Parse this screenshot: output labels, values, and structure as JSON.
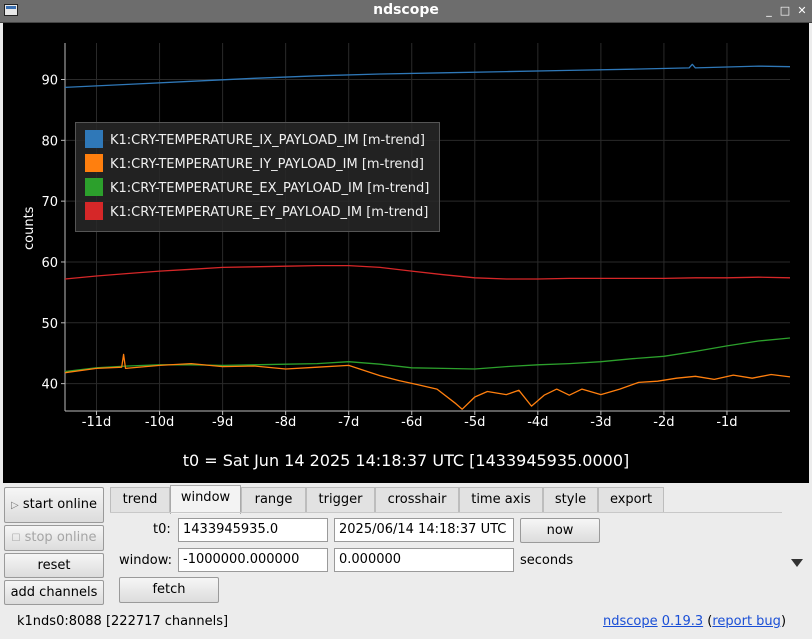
{
  "window": {
    "title": "ndscope"
  },
  "window_buttons": [
    "_",
    "□",
    "✕"
  ],
  "plot": {
    "ylabel": "counts",
    "t0_label": "t0 = Sat Jun 14 2025 14:18:37 UTC [1433945935.0000]",
    "legend": [
      {
        "name": "K1:CRY-TEMPERATURE_IX_PAYLOAD_IM [m-trend]",
        "color": "#2f78b8"
      },
      {
        "name": "K1:CRY-TEMPERATURE_IY_PAYLOAD_IM [m-trend]",
        "color": "#ff7f0e"
      },
      {
        "name": "K1:CRY-TEMPERATURE_EX_PAYLOAD_IM [m-trend]",
        "color": "#2ca02c"
      },
      {
        "name": "K1:CRY-TEMPERATURE_EY_PAYLOAD_IM [m-trend]",
        "color": "#d62728"
      }
    ]
  },
  "chart_data": {
    "type": "line",
    "title": "",
    "xlabel": "",
    "ylabel": "counts",
    "xlim": [
      -11.5,
      0
    ],
    "ylim": [
      35.5,
      96
    ],
    "xticks": [
      -11,
      -10,
      -9,
      -8,
      -7,
      -6,
      -5,
      -4,
      -3,
      -2,
      -1
    ],
    "xtick_labels": [
      "-11d",
      "-10d",
      "-9d",
      "-8d",
      "-7d",
      "-6d",
      "-5d",
      "-4d",
      "-3d",
      "-2d",
      "-1d"
    ],
    "yticks": [
      40,
      50,
      60,
      70,
      80,
      90
    ],
    "grid": true,
    "legend_position": "top-left",
    "series": [
      {
        "name": "K1:CRY-TEMPERATURE_IX_PAYLOAD_IM [m-trend]",
        "color": "#2f78b8",
        "x": [
          -11.5,
          -10.5,
          -9.5,
          -8.5,
          -7.5,
          -6.5,
          -5.5,
          -4.5,
          -3.5,
          -2.5,
          -1.6,
          -1.55,
          -1.5,
          -0.5,
          0
        ],
        "y": [
          88.7,
          89.2,
          89.7,
          90.2,
          90.6,
          90.9,
          91.1,
          91.3,
          91.5,
          91.7,
          91.9,
          92.5,
          91.9,
          92.2,
          92.1
        ]
      },
      {
        "name": "K1:CRY-TEMPERATURE_IY_PAYLOAD_IM [m-trend]",
        "color": "#ff7f0e",
        "x": [
          -11.5,
          -11,
          -10.6,
          -10.57,
          -10.54,
          -10,
          -9.5,
          -9,
          -8.5,
          -8,
          -7.5,
          -7,
          -6.5,
          -6.2,
          -5.9,
          -5.6,
          -5.3,
          -5.2,
          -5,
          -4.8,
          -4.5,
          -4.3,
          -4.1,
          -3.9,
          -3.7,
          -3.5,
          -3.3,
          -3,
          -2.7,
          -2.4,
          -2.1,
          -1.8,
          -1.5,
          -1.2,
          -0.9,
          -0.6,
          -0.3,
          0
        ],
        "y": [
          41.8,
          42.5,
          42.7,
          44.8,
          42.5,
          43,
          43.3,
          42.8,
          42.9,
          42.4,
          42.7,
          43,
          41.3,
          40.5,
          39.8,
          39.1,
          36.7,
          35.8,
          37.8,
          38.7,
          38.2,
          38.9,
          36.3,
          38.1,
          39.1,
          38.1,
          39.1,
          38.2,
          39.1,
          40.2,
          40.4,
          40.9,
          41.2,
          40.7,
          41.4,
          40.9,
          41.5,
          41.1
        ]
      },
      {
        "name": "K1:CRY-TEMPERATURE_EX_PAYLOAD_IM [m-trend]",
        "color": "#2ca02c",
        "x": [
          -11.5,
          -11,
          -10.5,
          -10,
          -9.5,
          -9,
          -8.5,
          -8,
          -7.5,
          -7,
          -6.5,
          -6,
          -5.5,
          -5,
          -4.5,
          -4,
          -3.5,
          -3,
          -2.5,
          -2,
          -1.5,
          -1,
          -0.5,
          0
        ],
        "y": [
          42,
          42.6,
          42.9,
          43.1,
          43.1,
          43,
          43.1,
          43.2,
          43.3,
          43.6,
          43.2,
          42.6,
          42.5,
          42.4,
          42.8,
          43.1,
          43.3,
          43.6,
          44.1,
          44.5,
          45.3,
          46.2,
          47,
          47.5
        ]
      },
      {
        "name": "K1:CRY-TEMPERATURE_EY_PAYLOAD_IM [m-trend]",
        "color": "#d62728",
        "x": [
          -11.5,
          -11,
          -10.5,
          -10,
          -9.5,
          -9,
          -8.5,
          -8,
          -7.5,
          -7,
          -6.5,
          -6,
          -5.5,
          -5,
          -4.5,
          -4,
          -3.5,
          -3,
          -2.5,
          -2,
          -1.5,
          -1,
          -0.5,
          0
        ],
        "y": [
          57.2,
          57.7,
          58.1,
          58.5,
          58.8,
          59.1,
          59.2,
          59.3,
          59.4,
          59.4,
          59.1,
          58.5,
          57.9,
          57.4,
          57.2,
          57.2,
          57.3,
          57.3,
          57.3,
          57.3,
          57.4,
          57.4,
          57.5,
          57.4
        ]
      }
    ]
  },
  "controls": {
    "start_online": "start online",
    "stop_online": "stop online",
    "reset": "reset",
    "add_channels": "add channels"
  },
  "tabs": [
    "trend",
    "window",
    "range",
    "trigger",
    "crosshair",
    "time axis",
    "style",
    "export"
  ],
  "active_tab": "window",
  "window_tab": {
    "t0_label": "t0:",
    "t0_gps": "1433945935.0",
    "t0_utc": "2025/06/14 14:18:37 UTC",
    "now_button": "now",
    "window_label": "window:",
    "window_start": "-1000000.000000",
    "window_end": "0.000000",
    "seconds_label": "seconds",
    "fetch_button": "fetch"
  },
  "status": {
    "server": "k1nds0:8088",
    "channels": "[222717 channels]",
    "app_name": "ndscope",
    "version": "0.19.3",
    "report_bug": "report bug"
  }
}
